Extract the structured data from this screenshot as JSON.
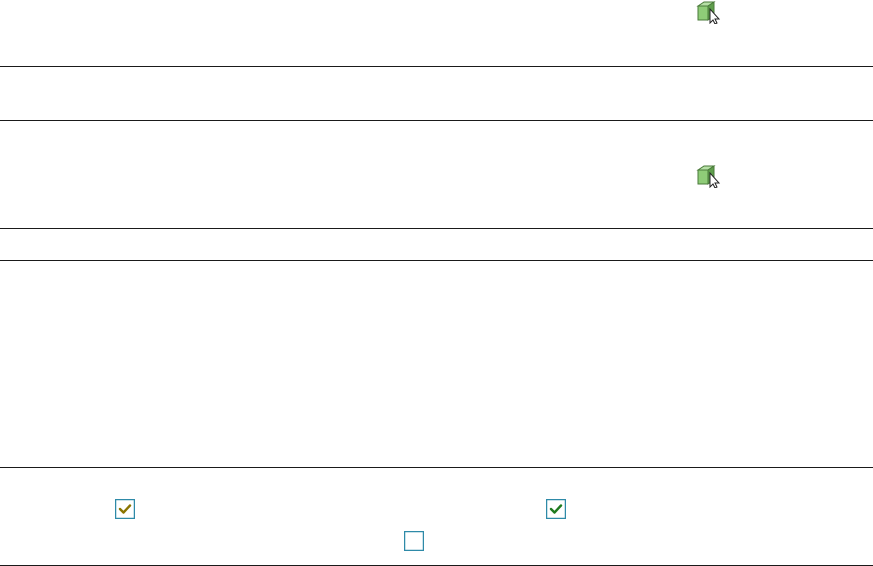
{
  "icons": {
    "select_tool": "cube-cursor-icon"
  },
  "colors": {
    "rule": "#1a1a1a",
    "checkbox_border": "#2e8aa8",
    "check_olive": "#8a7400",
    "check_green": "#1e7a1e",
    "cube_green": "#7fbf6a"
  },
  "checkboxes": [
    {
      "checked": true,
      "check_color": "olive"
    },
    {
      "checked": true,
      "check_color": "green"
    },
    {
      "checked": false
    }
  ]
}
